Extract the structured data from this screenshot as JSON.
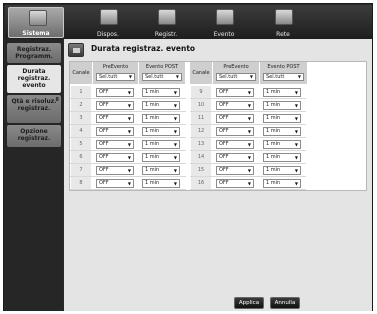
{
  "top_tabs": [
    {
      "label": "Sistema",
      "icon": "monitor-icon",
      "active": true
    },
    {
      "label": "Dispos.",
      "icon": "camera-icon",
      "active": false
    },
    {
      "label": "Registr.",
      "icon": "recorder-icon",
      "active": false
    },
    {
      "label": "Evento",
      "icon": "event-monitor-icon",
      "active": false
    },
    {
      "label": "Rete",
      "icon": "network-icon",
      "active": false
    }
  ],
  "left_nav": [
    {
      "label": "Registraz. Programm.",
      "active": false
    },
    {
      "label": "Durata registraz. evento",
      "active": true
    },
    {
      "label": "Qtà e risoluz. registraz.",
      "active": false,
      "marker": "8"
    },
    {
      "label": "Opzione registraz.",
      "active": false
    }
  ],
  "page_title": "Durata registraz. evento",
  "grid": {
    "header_canale": "Canale",
    "header_pre": "PreEvento",
    "header_post": "Evento POST",
    "header_select_value": "Sel.tutt"
  },
  "rows_left": [
    {
      "ch": "1",
      "pre": "OFF",
      "post": "1 min"
    },
    {
      "ch": "2",
      "pre": "OFF",
      "post": "1 min"
    },
    {
      "ch": "3",
      "pre": "OFF",
      "post": "1 min"
    },
    {
      "ch": "4",
      "pre": "OFF",
      "post": "1 min"
    },
    {
      "ch": "5",
      "pre": "OFF",
      "post": "1 min"
    },
    {
      "ch": "6",
      "pre": "OFF",
      "post": "1 min"
    },
    {
      "ch": "7",
      "pre": "OFF",
      "post": "1 min"
    },
    {
      "ch": "8",
      "pre": "OFF",
      "post": "1 min"
    }
  ],
  "rows_right": [
    {
      "ch": "9",
      "pre": "OFF",
      "post": "1 min"
    },
    {
      "ch": "10",
      "pre": "OFF",
      "post": "1 min"
    },
    {
      "ch": "11",
      "pre": "OFF",
      "post": "1 min"
    },
    {
      "ch": "12",
      "pre": "OFF",
      "post": "1 min"
    },
    {
      "ch": "13",
      "pre": "OFF",
      "post": "1 min"
    },
    {
      "ch": "14",
      "pre": "OFF",
      "post": "1 min"
    },
    {
      "ch": "15",
      "pre": "OFF",
      "post": "1 min"
    },
    {
      "ch": "16",
      "pre": "OFF",
      "post": "1 min"
    }
  ],
  "buttons": {
    "apply": "Applica",
    "cancel": "Annulla"
  }
}
